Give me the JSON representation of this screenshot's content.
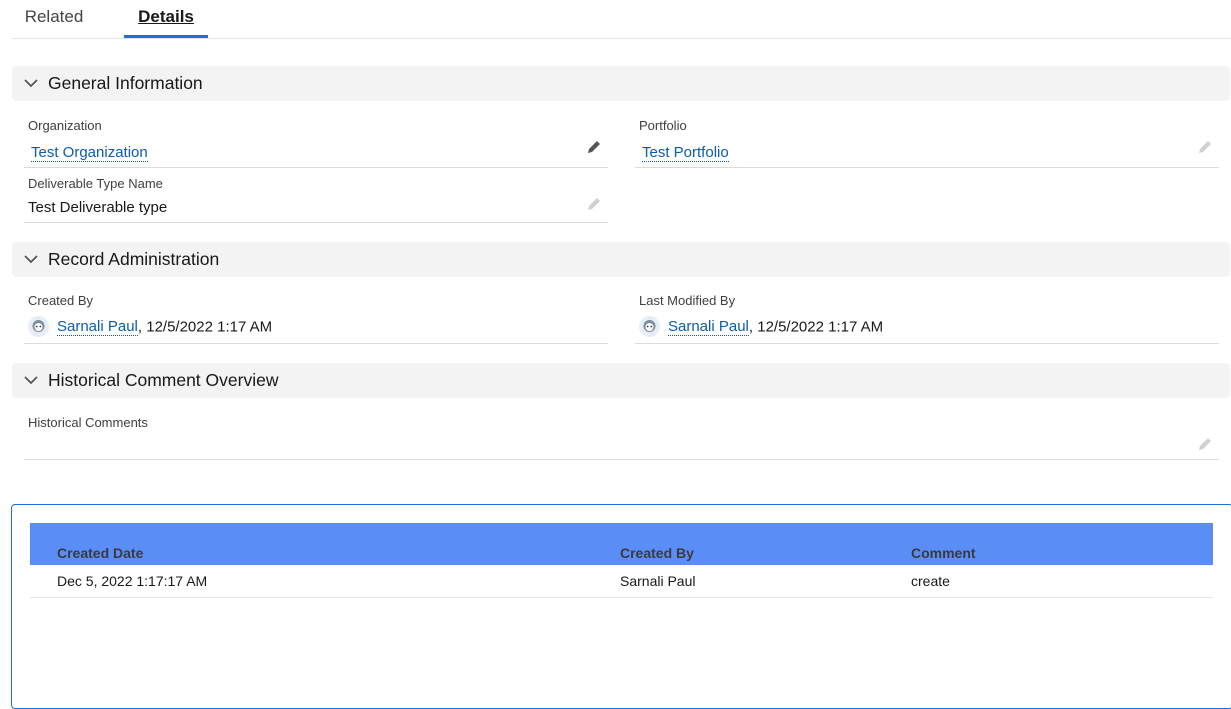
{
  "tabs": [
    {
      "label": "Related"
    },
    {
      "label": "Details"
    }
  ],
  "sections": {
    "general": {
      "title": "General Information"
    },
    "record_admin": {
      "title": "Record Administration"
    },
    "historical": {
      "title": "Historical Comment Overview"
    }
  },
  "fields": {
    "organization": {
      "label": "Organization",
      "value": "Test Organization"
    },
    "portfolio": {
      "label": "Portfolio",
      "value": "Test Portfolio"
    },
    "deliverable_type_name": {
      "label": "Deliverable Type Name",
      "value": "Test Deliverable type"
    },
    "created_by": {
      "label": "Created By",
      "user": "Sarnali Paul",
      "timestamp": ", 12/5/2022 1:17 AM"
    },
    "last_modified_by": {
      "label": "Last Modified By",
      "user": "Sarnali Paul",
      "timestamp": ", 12/5/2022 1:17 AM"
    },
    "historical_comments": {
      "label": "Historical Comments",
      "value": ""
    }
  },
  "comments_table": {
    "headers": [
      "Created Date",
      "Created By",
      "Comment"
    ],
    "rows": [
      [
        "Dec 5, 2022 1:17:17 AM",
        "Sarnali Paul",
        "create"
      ]
    ]
  },
  "colors": {
    "accent": "#1b6fd8",
    "link": "#0b5cab",
    "table_header": "#5a8ef6",
    "section_bg": "#f3f3f3"
  }
}
